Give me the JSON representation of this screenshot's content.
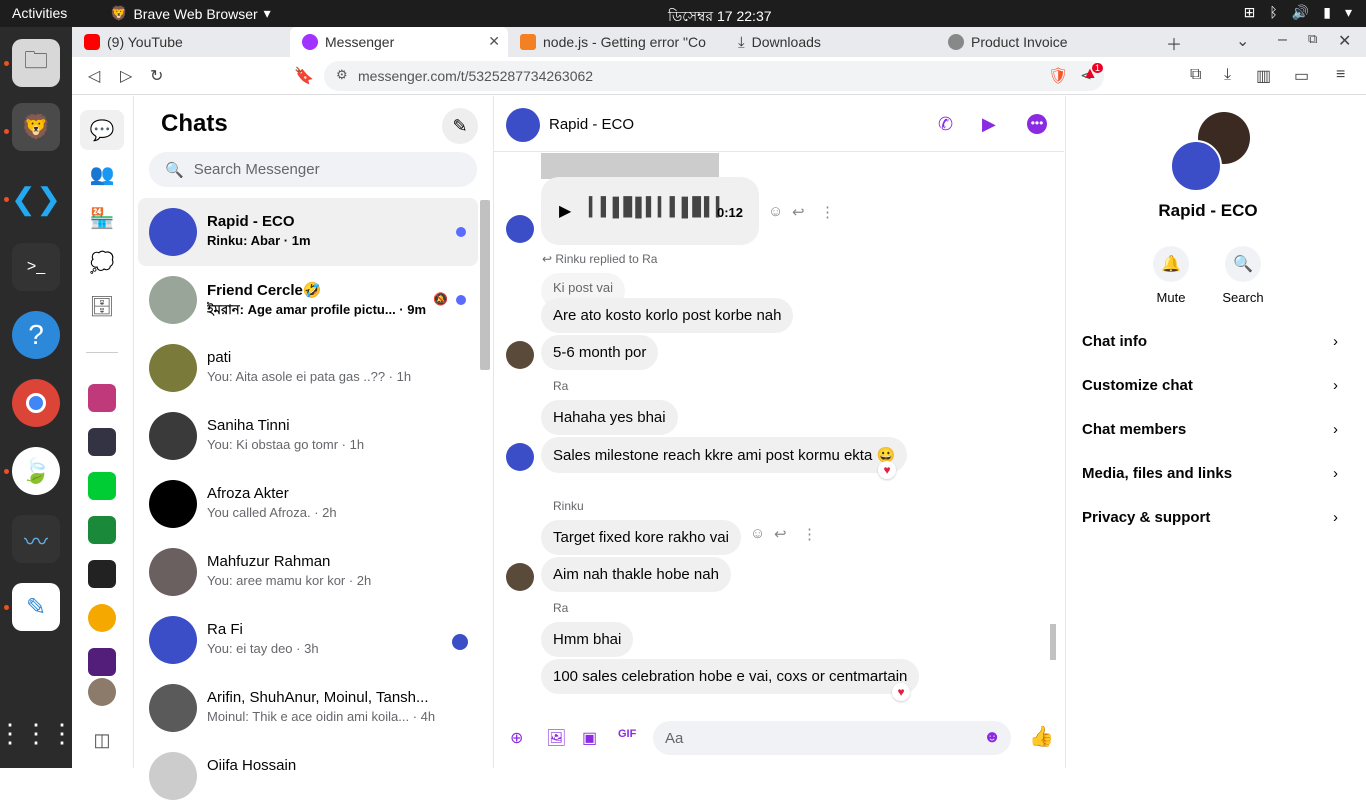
{
  "os": {
    "activities": "Activities",
    "app_name": "Brave Web Browser",
    "clock": "ডিসেম্বর 17  22:37"
  },
  "browser": {
    "tabs": [
      {
        "label": "(9) YouTube"
      },
      {
        "label": "Messenger"
      },
      {
        "label": "node.js - Getting error \"Co"
      },
      {
        "label": "Downloads"
      },
      {
        "label": "Product Invoice"
      }
    ],
    "url": "messenger.com/t/5325287734263062",
    "shield_count": "1"
  },
  "chats": {
    "title": "Chats",
    "search_placeholder": "Search Messenger",
    "items": [
      {
        "name": "Rapid - ECO",
        "preview": "Rinku: Abar · 1m"
      },
      {
        "name": "Friend Cercle🤣",
        "preview": "ইমরান: Age amar profile pictu... · 9m"
      },
      {
        "name": "pati",
        "preview": "You: Aita asole ei pata gas ..?? · 1h"
      },
      {
        "name": "Saniha Tinni",
        "preview": "You: Ki obstaa go tomr · 1h"
      },
      {
        "name": "Afroza Akter",
        "preview": "You called Afroza. · 2h"
      },
      {
        "name": "Mahfuzur Rahman",
        "preview": "You: aree mamu kor kor · 2h"
      },
      {
        "name": "Ra Fi",
        "preview": "You: ei tay deo · 3h"
      },
      {
        "name": "Arifin, ShuhAnur, Moinul, Tansh...",
        "preview": "Moinul: Thik e ace oidin ami koila... · 4h"
      },
      {
        "name": "Oiifa Hossain",
        "preview": ""
      }
    ]
  },
  "conversation": {
    "title": "Rapid - ECO",
    "audio_duration": "0:12",
    "reply_note": "Rinku replied to Ra",
    "quoted": "Ki post vai",
    "messages": [
      "Are ato kosto korlo post korbe nah",
      "5-6 month por",
      "Hahaha yes bhai",
      "Sales milestone reach kkre ami post kormu ekta 😀",
      "Target fixed kore rakho vai",
      "Aim nah thakle hobe nah",
      "Hmm bhai",
      "100 sales celebration hobe e vai, coxs or centmartain"
    ],
    "sender_ra": "Ra",
    "sender_rinku": "Rinku",
    "input_placeholder": "Aa"
  },
  "info": {
    "name": "Rapid - ECO",
    "mute_label": "Mute",
    "search_label": "Search",
    "rows": [
      "Chat info",
      "Customize chat",
      "Chat members",
      "Media, files and links",
      "Privacy & support"
    ]
  }
}
